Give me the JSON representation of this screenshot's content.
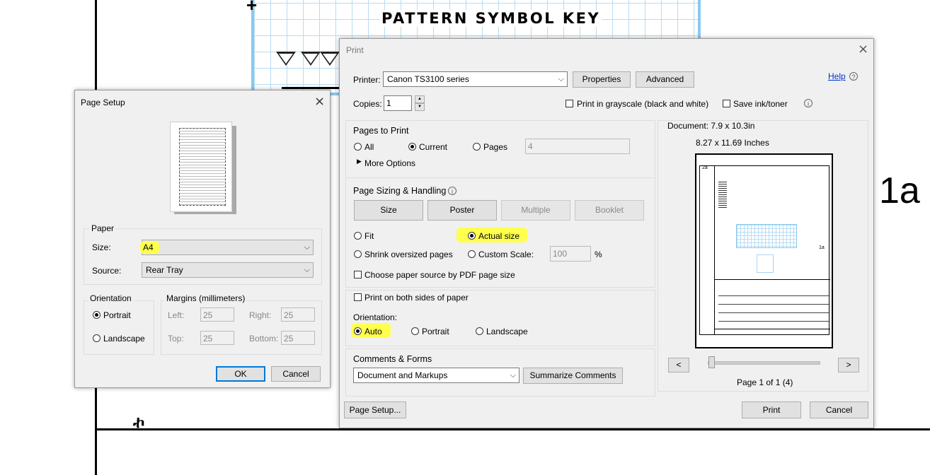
{
  "background": {
    "heading": "PATTERN SYMBOL KEY",
    "side_label": "1a",
    "bottom_glyph": "ኯ"
  },
  "page_setup": {
    "title": "Page Setup",
    "paper_group": "Paper",
    "size_label": "Size:",
    "size_value": "A4",
    "source_label": "Source:",
    "source_value": "Rear Tray",
    "orientation_group": "Orientation",
    "portrait": "Portrait",
    "landscape": "Landscape",
    "margins_group": "Margins (millimeters)",
    "left_label": "Left:",
    "left_value": "25",
    "right_label": "Right:",
    "right_value": "25",
    "top_label": "Top:",
    "top_value": "25",
    "bottom_label": "Bottom:",
    "bottom_value": "25",
    "ok": "OK",
    "cancel": "Cancel"
  },
  "print": {
    "title": "Print",
    "printer_label": "Printer:",
    "printer_value": "Canon TS3100 series",
    "properties": "Properties",
    "advanced": "Advanced",
    "help": "Help",
    "copies_label": "Copies:",
    "copies_value": "1",
    "grayscale": "Print in grayscale (black and white)",
    "save_ink": "Save ink/toner",
    "pages_to_print": {
      "heading": "Pages to Print",
      "all": "All",
      "current": "Current",
      "pages": "Pages",
      "pages_value": "4",
      "more_options": "More Options"
    },
    "sizing": {
      "heading": "Page Sizing & Handling",
      "tabs": [
        "Size",
        "Poster",
        "Multiple",
        "Booklet"
      ],
      "fit": "Fit",
      "actual_size": "Actual size",
      "shrink": "Shrink oversized pages",
      "custom_scale": "Custom Scale:",
      "scale_value": "100",
      "percent": "%",
      "choose_source": "Choose paper source by PDF page size"
    },
    "both_sides": "Print on both sides of paper",
    "orientation": {
      "label": "Orientation:",
      "auto": "Auto",
      "portrait": "Portrait",
      "landscape": "Landscape"
    },
    "comments": {
      "heading": "Comments & Forms",
      "value": "Document and Markups",
      "summarize": "Summarize Comments"
    },
    "preview": {
      "document_size": "Document: 7.9 x 10.3in",
      "paper_size": "8.27 x 11.69 Inches",
      "page_label": "2a",
      "side_label": "1a",
      "prev": "<",
      "next": ">",
      "page_status": "Page 1 of 1 (4)"
    },
    "page_setup_button": "Page Setup...",
    "print_button": "Print",
    "cancel_button": "Cancel"
  },
  "colors": {
    "highlight": "#ffff4d",
    "grid_blue": "#8ac9ee",
    "focus_blue": "#0078d7"
  }
}
